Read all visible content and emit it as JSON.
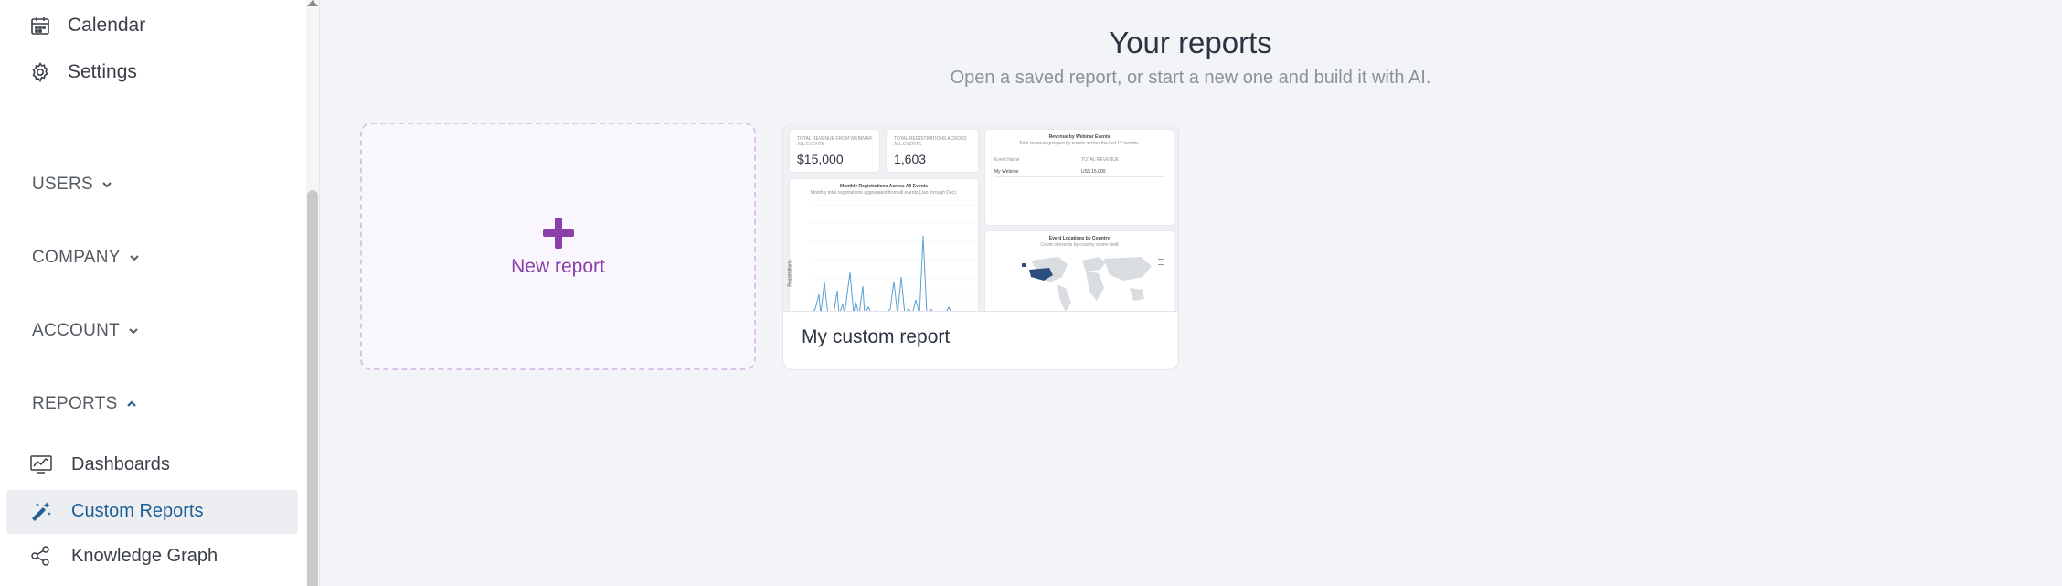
{
  "sidebar": {
    "nav": [
      {
        "label": "Calendar",
        "icon": "calendar-icon"
      },
      {
        "label": "Settings",
        "icon": "gear-icon"
      }
    ],
    "sections": [
      {
        "label": "USERS",
        "state": "collapsed"
      },
      {
        "label": "COMPANY",
        "state": "collapsed"
      },
      {
        "label": "ACCOUNT",
        "state": "collapsed"
      },
      {
        "label": "REPORTS",
        "state": "expanded"
      }
    ],
    "reports_items": [
      {
        "label": "Dashboards",
        "icon": "dashboard-icon"
      },
      {
        "label": "Custom Reports",
        "icon": "magic-wand-icon",
        "active": true
      },
      {
        "label": "Knowledge Graph",
        "icon": "share-nodes-icon"
      }
    ]
  },
  "main": {
    "title": "Your reports",
    "subtitle": "Open a saved report, or start a new one and build it with AI.",
    "new_report_label": "New report",
    "cards": [
      {
        "title": "My custom report",
        "thumbnail": {
          "kpi_1": {
            "label": "TOTAL REVENUE FROM WEBINAR ALL EVENTS",
            "value": "$15,000"
          },
          "kpi_2": {
            "label": "TOTAL REGISTRATIONS ACROSS ALL EVENTS",
            "value": "1,603"
          },
          "line_chart_title": "Monthly Registrations Across All Events",
          "line_chart_subtitle": "Monthly total registrations aggregated from all events (Jan through Dec).",
          "line_chart_ylabel": "Registrations",
          "table_title": "Revenue by Webinar Events",
          "table_subtitle": "Total revenue grouped by events across the last 12 months.",
          "table_headers": [
            "Event Name",
            "TOTAL REVENUE"
          ],
          "table_rows": [
            [
              "My Webinar",
              "US$ 15,000"
            ]
          ],
          "map_title": "Event Locations by Country",
          "map_subtitle": "Count of events by country where held"
        }
      }
    ]
  },
  "colors": {
    "accent_purple": "#8b3fa8",
    "active_blue": "#1f5f96",
    "background": "#f3f4f7"
  }
}
